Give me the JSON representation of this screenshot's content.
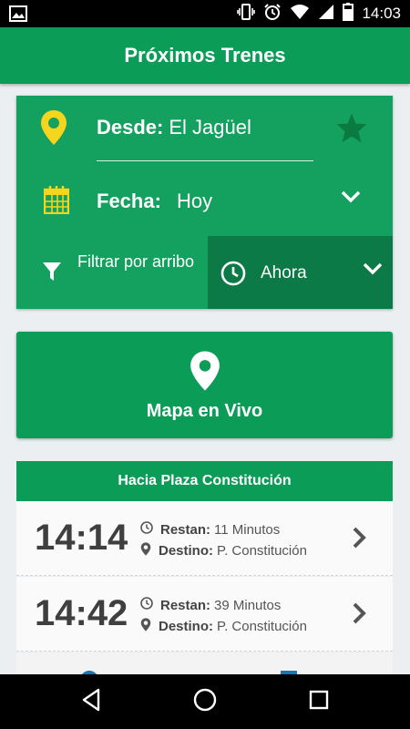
{
  "status_bar": {
    "time": "14:03",
    "icons": [
      "image-icon",
      "vibrate-icon",
      "alarm-icon",
      "wifi-icon",
      "signal-icon",
      "battery-icon"
    ]
  },
  "app_bar": {
    "title": "Próximos Trenes"
  },
  "search": {
    "desde_label": "Desde:",
    "desde_value": "El Jagüel",
    "fecha_label": "Fecha:",
    "fecha_value": "Hoy",
    "filter_label": "Filtrar por arribo",
    "time_value": "Ahora"
  },
  "map_button": {
    "label": "Mapa en Vivo"
  },
  "departures": {
    "header": "Hacia Plaza Constitución",
    "restan_label": "Restan:",
    "destino_label": "Destino:",
    "rows": [
      {
        "time": "14:14",
        "restan": "11 Minutos",
        "destino": "P. Constitución"
      },
      {
        "time": "14:42",
        "restan": "39 Minutos",
        "destino": "P. Constitución"
      }
    ]
  },
  "colors": {
    "primary": "#0b9d58",
    "card": "#14a160",
    "dark_green": "#0c7a46",
    "accent_yellow": "#f6d51e",
    "star": "#0a7a40"
  }
}
